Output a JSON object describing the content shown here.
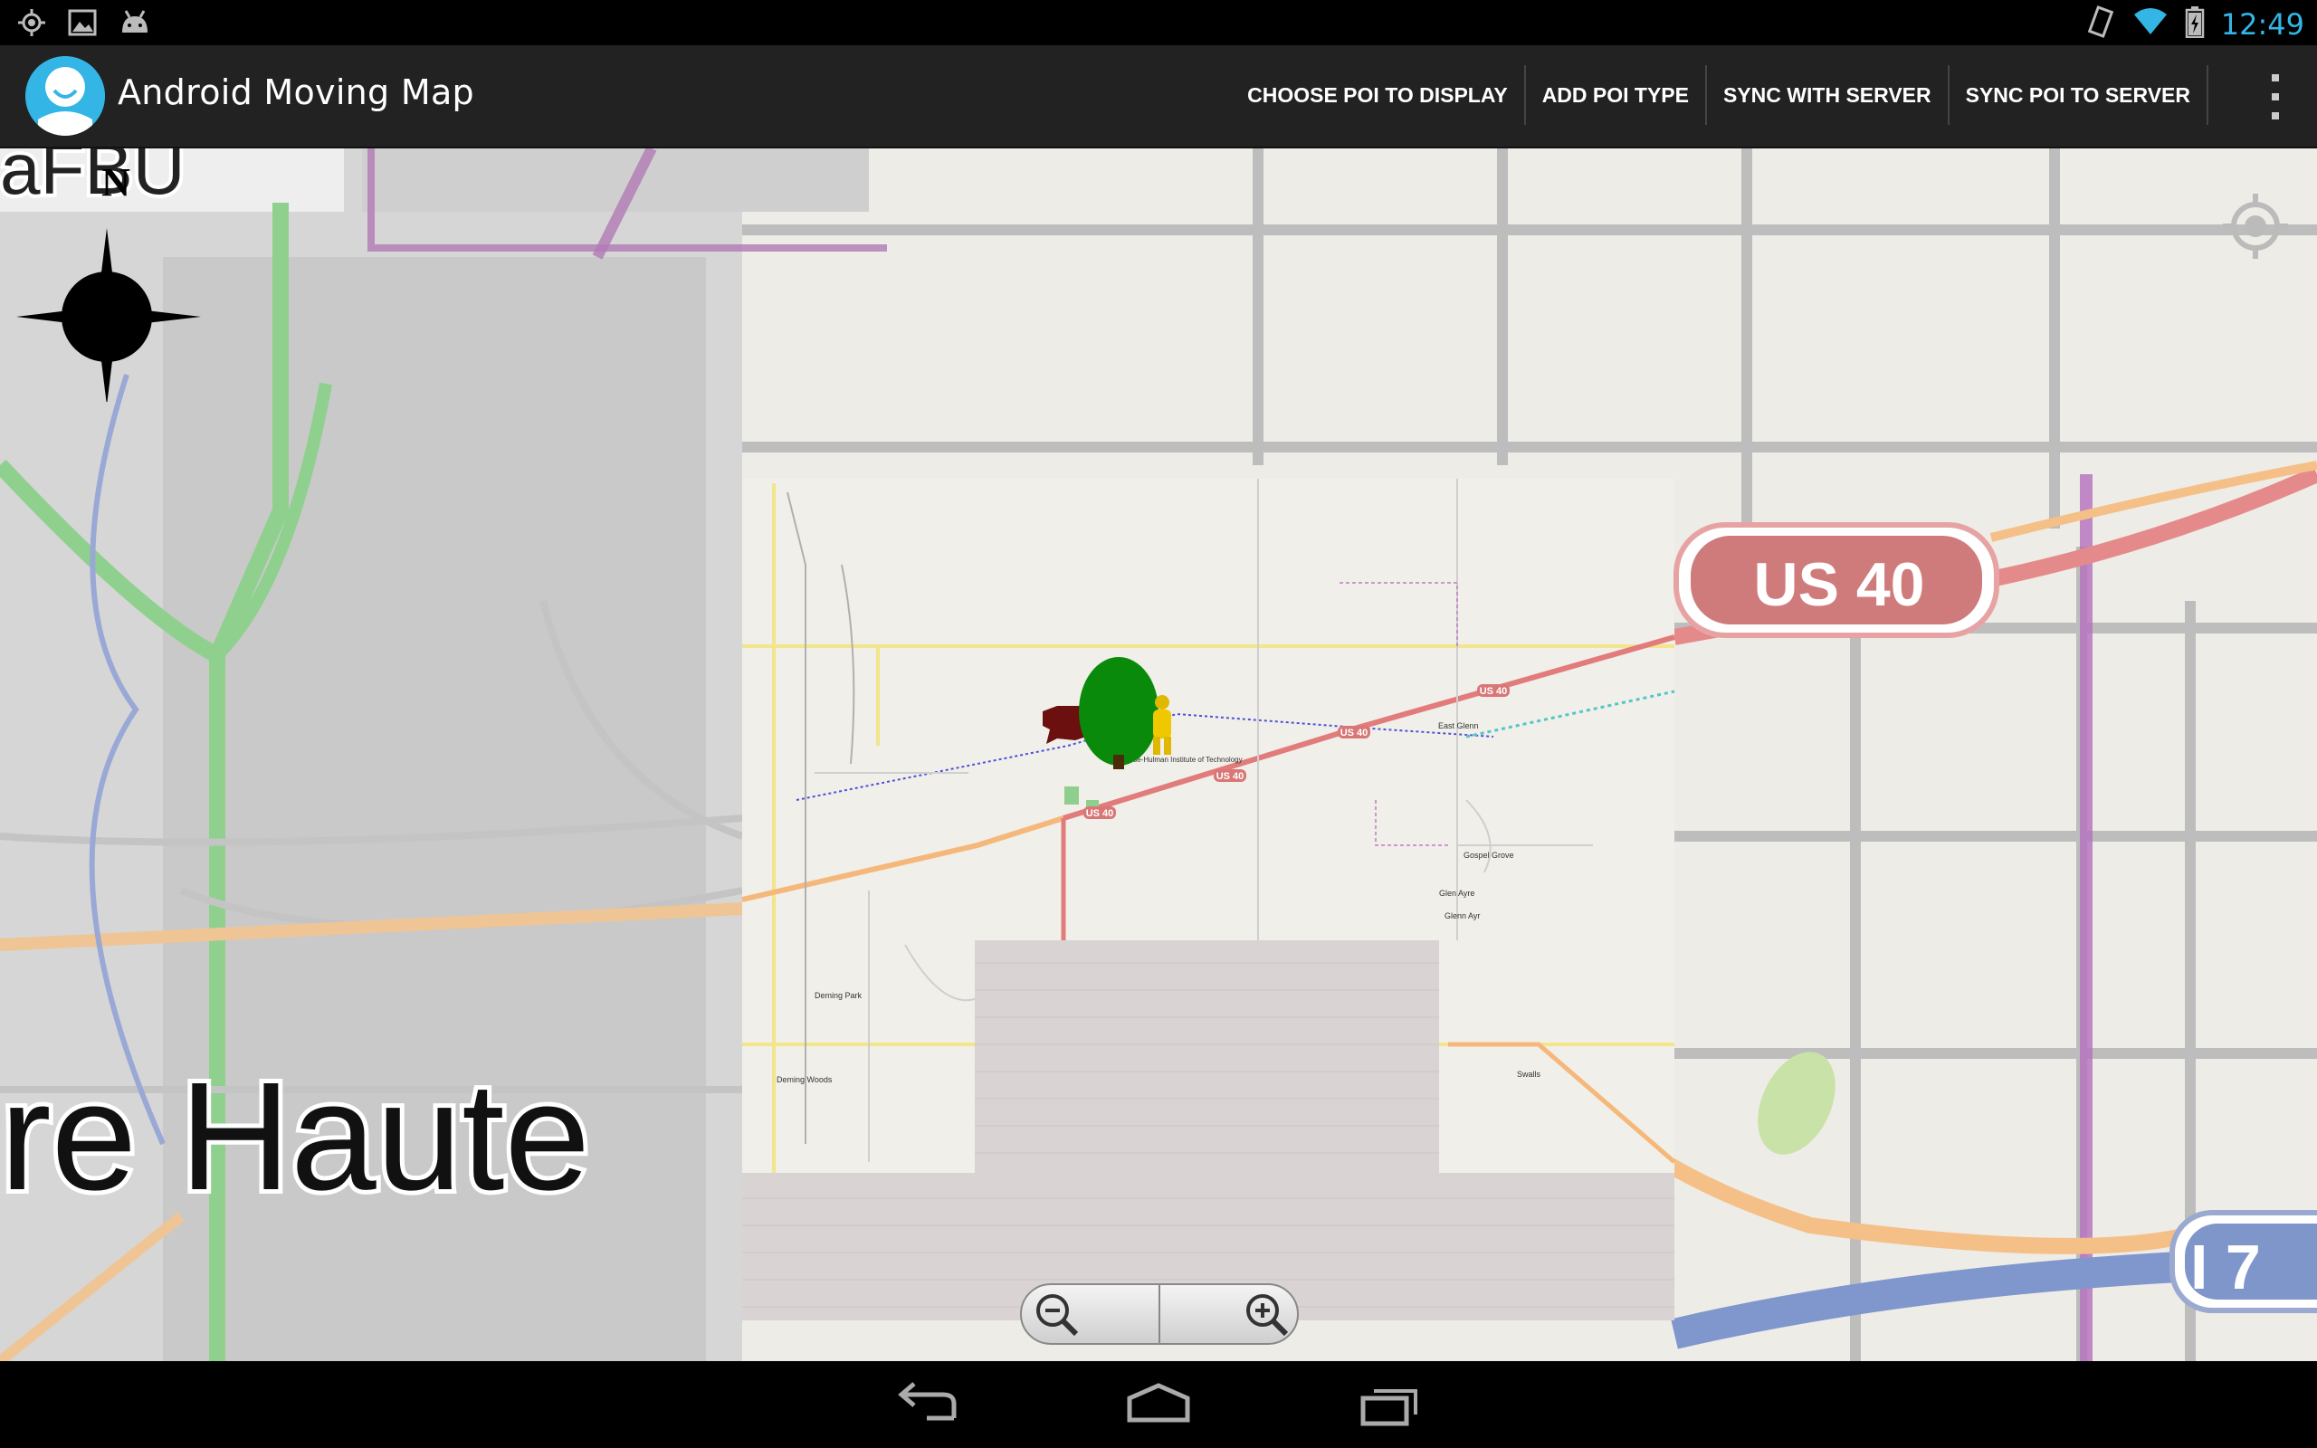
{
  "status_bar": {
    "icons_left": [
      "location-icon",
      "image-icon",
      "android-icon"
    ],
    "icons_right": [
      "vibrate-icon",
      "wifi-icon",
      "battery-icon"
    ],
    "time": "12:49",
    "accent_color": "#33b5e5"
  },
  "action_bar": {
    "title": "Android Moving Map",
    "actions": [
      {
        "label": "CHOOSE POI TO DISPLAY"
      },
      {
        "label": "ADD POI TYPE"
      },
      {
        "label": "SYNC WITH SERVER"
      },
      {
        "label": "SYNC POI TO SERVER"
      }
    ],
    "overflow_icon": "overflow-menu-icon"
  },
  "map": {
    "compass_label": "N",
    "city_label": "re Haute",
    "top_left_label": "aFBU",
    "highway_shield": "US 40",
    "interstate_shield": "I 7",
    "place_labels": [
      "Gospel Grove",
      "Glen Ayre",
      "Glenn Ayr",
      "Deming Park",
      "Deming Woods",
      "Swalls",
      "East Glenn",
      "Rose-Hulman Institute of Technology"
    ],
    "road_shields": [
      "US 40",
      "US 40",
      "US 40",
      "US 40"
    ],
    "poi_markers": [
      "landmark-poi-icon",
      "tree-poi-icon",
      "person-poi-icon"
    ]
  },
  "zoom": {
    "zoom_out_icon": "zoom-out-icon",
    "zoom_in_icon": "zoom-in-icon"
  },
  "nav_bar": {
    "buttons": [
      "back-icon",
      "home-icon",
      "recent-apps-icon"
    ]
  }
}
